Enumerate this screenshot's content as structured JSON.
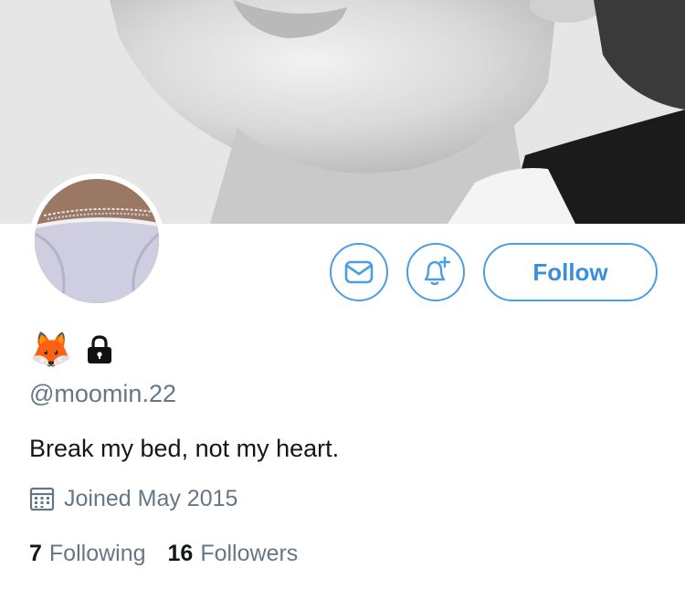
{
  "profile": {
    "name_emoji": "🦊",
    "handle": "@moomin.22",
    "bio": "Break my bed, not my heart.",
    "joined": "Joined May 2015",
    "following_count": "7",
    "following_label": "Following",
    "followers_count": "16",
    "followers_label": "Followers"
  },
  "actions": {
    "follow_label": "Follow"
  },
  "icons": {
    "message": "envelope-icon",
    "notify": "bell-plus-icon",
    "protected": "lock-icon",
    "joined": "calendar-icon"
  },
  "colors": {
    "accent": "#4a9ee6",
    "secondary_text": "#657786",
    "primary_text": "#14171a"
  }
}
